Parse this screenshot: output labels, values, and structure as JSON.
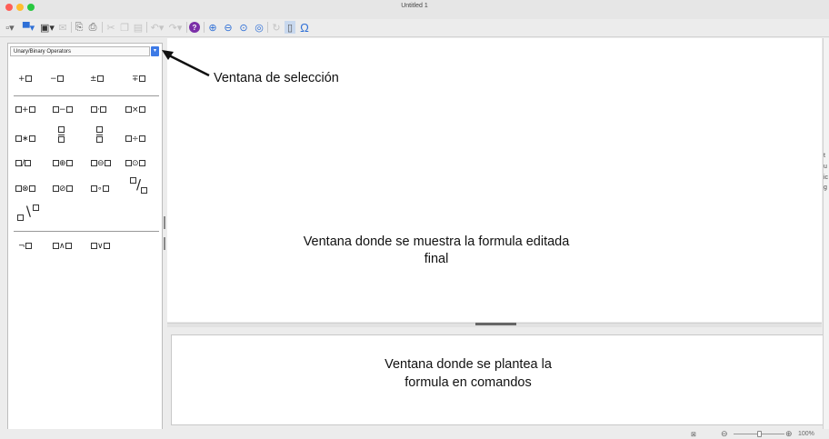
{
  "window": {
    "title": "Untitled 1"
  },
  "toolbar": {
    "icons": [
      {
        "name": "new-document-icon",
        "glyph": "▫▾"
      },
      {
        "name": "open-icon",
        "glyph": "▀▾"
      },
      {
        "name": "save-icon",
        "glyph": "▣▾"
      },
      {
        "name": "email-icon",
        "glyph": "✉"
      },
      {
        "name": "export-pdf-icon",
        "glyph": "⎘"
      },
      {
        "name": "print-icon",
        "glyph": "⎙"
      },
      {
        "name": "cut-icon",
        "glyph": "✂"
      },
      {
        "name": "copy-icon",
        "glyph": "❐"
      },
      {
        "name": "paste-icon",
        "glyph": "▤"
      },
      {
        "name": "undo-icon",
        "glyph": "↶▾"
      },
      {
        "name": "redo-icon",
        "glyph": "↷▾"
      },
      {
        "name": "help-icon",
        "glyph": "?"
      },
      {
        "name": "zoom-in-icon",
        "glyph": "⊕"
      },
      {
        "name": "zoom-out-icon",
        "glyph": "⊖"
      },
      {
        "name": "zoom-100-icon",
        "glyph": "⊙"
      },
      {
        "name": "show-all-icon",
        "glyph": "◎"
      },
      {
        "name": "update-icon",
        "glyph": "↻"
      },
      {
        "name": "formula-cursor-icon",
        "glyph": "▯"
      },
      {
        "name": "symbols-icon",
        "glyph": "Ω"
      }
    ]
  },
  "elements": {
    "category": "Unary/Binary Operators",
    "unary": [
      "+□",
      "−□",
      "±□",
      "∓□"
    ],
    "binary": [
      [
        "□+□",
        "□−□",
        "□·□",
        "□×□"
      ],
      [
        "□∗□",
        "□/□ frac",
        "□/□ frac",
        "□÷□"
      ],
      [
        "□/□",
        "□⊕□",
        "□⊖□",
        "□⊙□"
      ],
      [
        "□⊗□",
        "□⊘□",
        "□∘□",
        "□/□ wide"
      ],
      [
        "□\\□"
      ]
    ],
    "logic": [
      "¬□",
      "□∧□",
      "□∨□"
    ]
  },
  "annotations": {
    "selection": "Ventana de selección",
    "formula_line1": "Ventana donde se muestra la formula editada",
    "formula_line2": "final",
    "commands_line1": "Ventana donde se plantea la",
    "commands_line2": "formula en comandos"
  },
  "statusbar": {
    "zoom": "100%"
  },
  "edge_fragments": [
    "t",
    "u",
    "ic",
    "g"
  ],
  "colors": {
    "accent": "#3d7ae6",
    "help": "#7b2fa8",
    "zoom": "#2e6fd6"
  }
}
